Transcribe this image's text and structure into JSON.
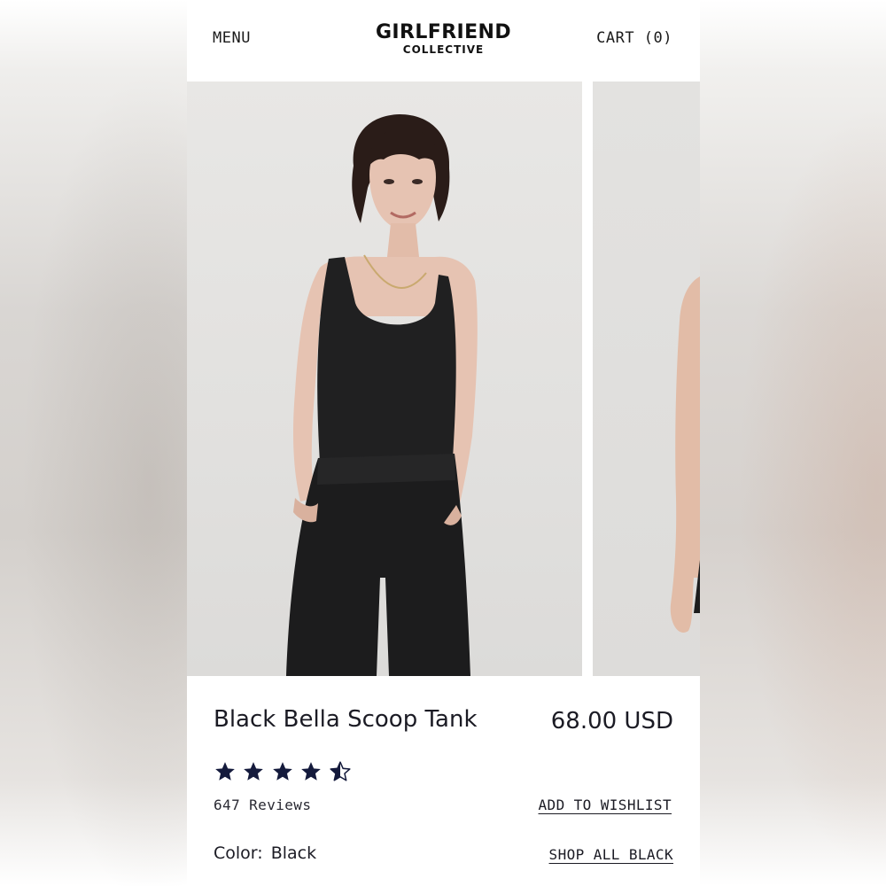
{
  "header": {
    "menu_label": "MENU",
    "brand_line1": "GIRLFRIEND",
    "brand_line2": "COLLECTIVE",
    "cart_label": "CART (0)"
  },
  "gallery": {
    "main_image": "model-wearing-black-scoop-tank-front",
    "next_image": "model-wearing-black-scoop-tank-partial"
  },
  "product": {
    "title": "Black Bella Scoop Tank",
    "price": "68.00 USD",
    "rating": 4.5,
    "rating_max": 5,
    "reviews": "647 Reviews",
    "wishlist_label": "ADD TO WISHLIST",
    "color_label": "Color:",
    "color_value": "Black",
    "shop_all_label": "SHOP ALL BLACK"
  },
  "colors": {
    "star": "#141a3c",
    "text": "#1b1b24",
    "garment": "#1f1f20"
  },
  "icons": {
    "star_full": "star-icon",
    "star_half": "star-half-icon"
  }
}
